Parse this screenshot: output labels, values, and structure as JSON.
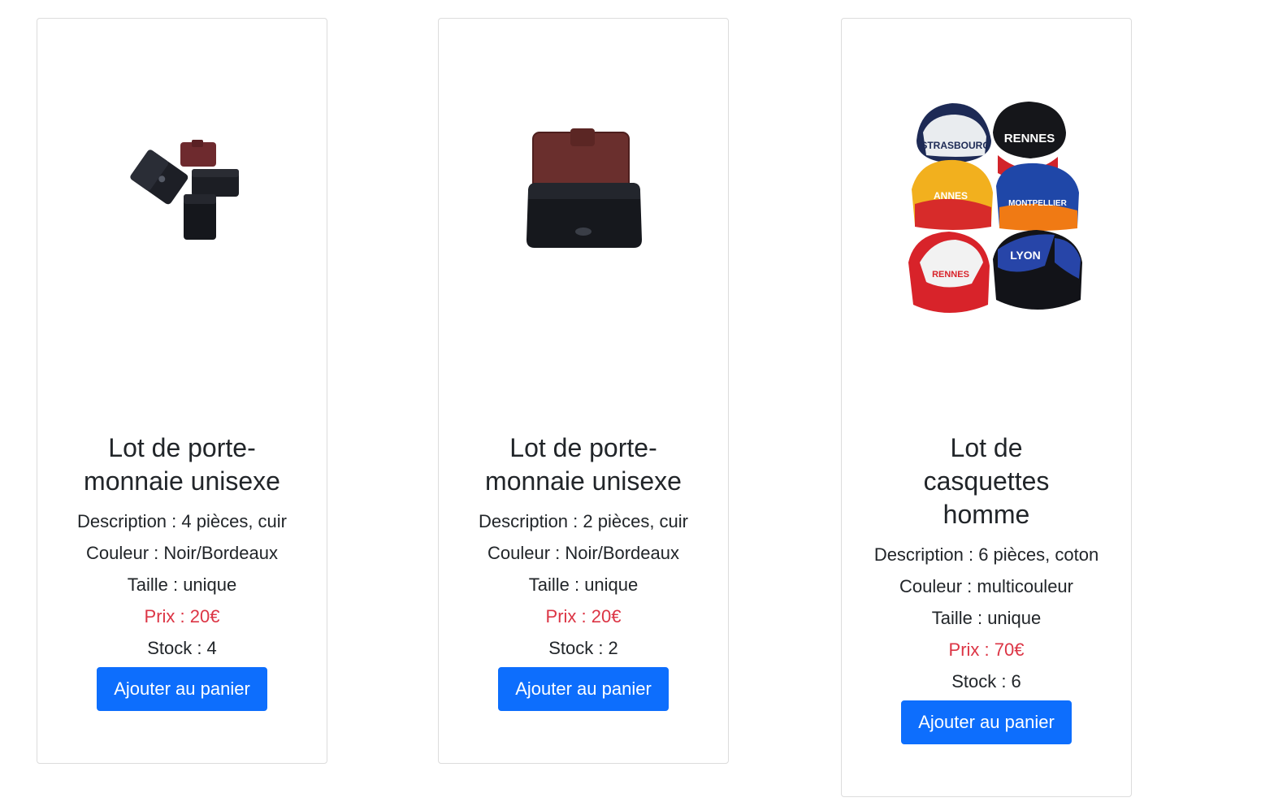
{
  "products": [
    {
      "title": "Lot de porte-monnaie unisexe",
      "description_label": "Description : 4 pièces, cuir",
      "color_label": "Couleur : Noir/Bordeaux",
      "size_label": "Taille : unique",
      "price_label": "Prix : 20€",
      "stock_label": "Stock : 4",
      "button_label": "Ajouter au panier",
      "image_name": "wallets-lot-image"
    },
    {
      "title": "Lot de porte-monnaie unisexe",
      "description_label": "Description : 2 pièces, cuir",
      "color_label": "Couleur : Noir/Bordeaux",
      "size_label": "Taille : unique",
      "price_label": "Prix : 20€",
      "stock_label": "Stock : 2",
      "button_label": "Ajouter au panier",
      "image_name": "wallets-pair-image"
    },
    {
      "title": "Lot de casquettes homme",
      "description_label": "Description : 6 pièces, coton",
      "color_label": "Couleur : multicouleur",
      "size_label": "Taille : unique",
      "price_label": "Prix : 70€",
      "stock_label": "Stock : 6",
      "button_label": "Ajouter au panier",
      "image_name": "caps-lot-image",
      "image_text": [
        "RENNES",
        "MONTPELLIER",
        "LYON"
      ]
    }
  ],
  "colors": {
    "price": "#dc3545",
    "button": "#0d6efd",
    "border": "#dcdcdc"
  }
}
